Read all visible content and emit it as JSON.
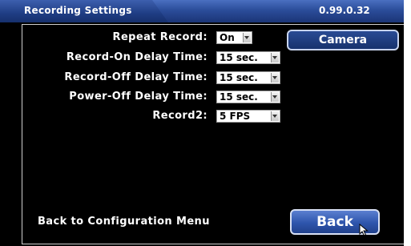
{
  "header": {
    "title": "Recording Settings",
    "version": "0.99.0.32"
  },
  "settings": [
    {
      "label": "Repeat Record:",
      "value": "On"
    },
    {
      "label": "Record-On Delay Time:",
      "value": "15 sec."
    },
    {
      "label": "Record-Off Delay Time:",
      "value": "15 sec."
    },
    {
      "label": "Power-Off Delay Time:",
      "value": "15 sec."
    },
    {
      "label": "Record2:",
      "value": "5 FPS"
    }
  ],
  "buttons": {
    "camera": "Camera",
    "back": "Back"
  },
  "footer": {
    "hint": "Back to Configuration Menu"
  },
  "colors": {
    "background": "#000000",
    "header_blue": "#2b4d9a",
    "button_blue": "#2e55ac"
  }
}
